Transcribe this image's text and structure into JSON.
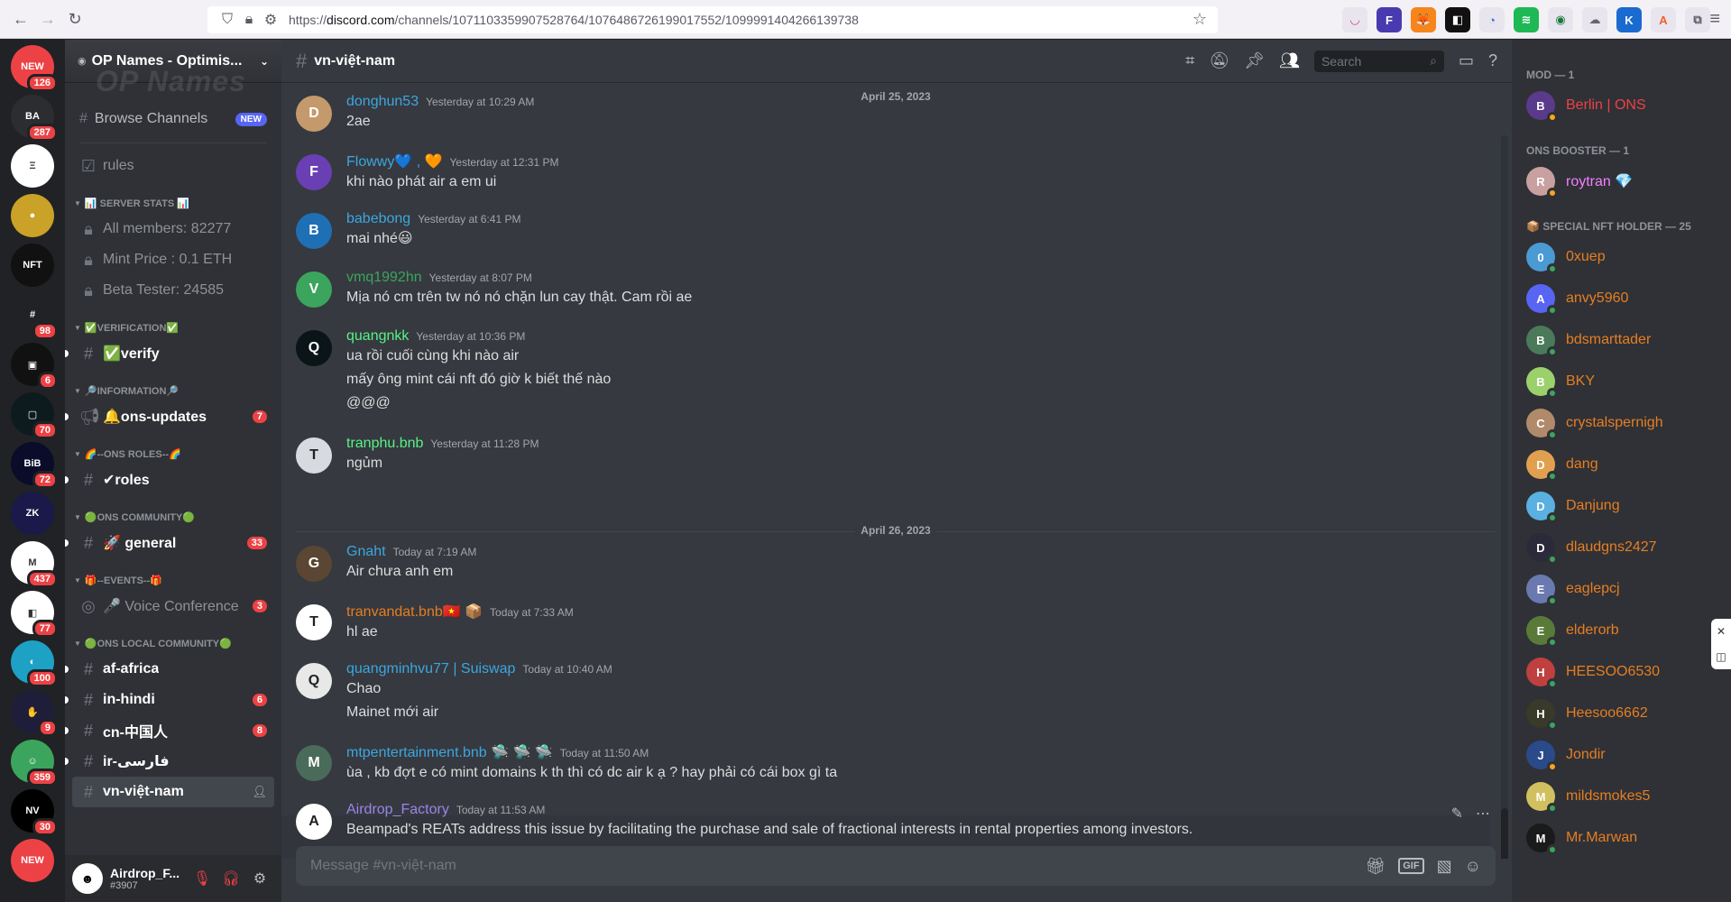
{
  "browser": {
    "url_prefix": "https://",
    "url_domain": "discord.com",
    "url_path": "/channels/1071103359907528764/1076486726199017552/1099991404266139738"
  },
  "servers": [
    {
      "label": "NEW",
      "badge": "126",
      "color": "#ed4245",
      "new": "NEW"
    },
    {
      "label": "BA",
      "badge": "287",
      "color": "#2b2d31"
    },
    {
      "label": "Ξ",
      "badge": "",
      "color": "#ffffff"
    },
    {
      "label": "●",
      "badge": "",
      "color": "#c9a227"
    },
    {
      "label": "NFT",
      "badge": "",
      "color": "#111111"
    },
    {
      "label": "#",
      "badge": "98",
      "color": "#202225"
    },
    {
      "label": "▣",
      "badge": "6",
      "color": "#111111"
    },
    {
      "label": "▢",
      "badge": "70",
      "color": "#0d1b1e"
    },
    {
      "label": "BiB",
      "badge": "72",
      "color": "#0b0b2a"
    },
    {
      "label": "ZK",
      "badge": "",
      "color": "#1a1a4a"
    },
    {
      "label": "M",
      "badge": "437",
      "color": "#ffffff"
    },
    {
      "label": "◧",
      "badge": "77",
      "color": "#ffffff"
    },
    {
      "label": "◐",
      "badge": "100",
      "color": "#1da1c4"
    },
    {
      "label": "✋",
      "badge": "9",
      "color": "#1e1e3a"
    },
    {
      "label": "☺",
      "badge": "359",
      "color": "#3ba55d"
    },
    {
      "label": "NV",
      "badge": "30",
      "color": "#000000"
    },
    {
      "label": "NEW",
      "badge": "",
      "color": "#ed4245",
      "new": "NEW"
    }
  ],
  "guild": {
    "name": "OP Names - Optimis...",
    "banner": "OP Names",
    "browse_label": "Browse Channels",
    "browse_badge": "NEW"
  },
  "channels": {
    "rules": "rules",
    "cat_server_stats": "📊 SERVER STATS 📊",
    "all_members": "All members: 82277",
    "mint_price": "Mint Price : 0.1 ETH",
    "beta_tester": "Beta Tester: 24585",
    "cat_verification": "✅VERIFICATION✅",
    "verify": "✅verify",
    "cat_information": "🔎INFORMATION🔎",
    "ons_updates": "🔔ons-updates",
    "ons_updates_count": "7",
    "cat_ons_roles": "🌈--ONS ROLES--🌈",
    "roles": "✔roles",
    "cat_ons_community": "🟢ONS COMMUNITY🟢",
    "general": "🚀 general",
    "general_count": "33",
    "cat_events": "🎁--EVENTS--🎁",
    "voice_conf": "🎤 Voice Conference",
    "voice_conf_count": "3",
    "cat_local": "🟢ONS LOCAL COMMUNITY🟢",
    "af_africa": "af-africa",
    "in_hindi": "in-hindi",
    "in_hindi_count": "6",
    "cn": "cn-中国人",
    "cn_count": "8",
    "ir": "ir-فارسی",
    "vn": "vn-việt-nam"
  },
  "user_panel": {
    "name": "Airdrop_F...",
    "tag": "#3907"
  },
  "chat": {
    "channel": "vn-việt-nam",
    "search_placeholder": "Search",
    "composer_placeholder": "Message #vn-việt-nam",
    "gif_label": "GIF",
    "partial_date": "April 25, 2023",
    "date_divider": "April 26, 2023",
    "messages": [
      {
        "user": "donghun53",
        "color": "#3ba7e0",
        "time": "Yesterday at 10:29 AM",
        "lines": [
          "2ae"
        ],
        "av": "#c49a6c"
      },
      {
        "user": "Flowwy💙 , 🧡",
        "color": "#3ba7e0",
        "time": "Yesterday at 12:31 PM",
        "lines": [
          "khi nào phát air a em ui"
        ],
        "av": "#6a3fb4"
      },
      {
        "user": "babebong",
        "color": "#3ba7e0",
        "time": "Yesterday at 6:41 PM",
        "lines": [
          "mai nhé😃"
        ],
        "av": "#1f6fb5"
      },
      {
        "user": "vmq1992hn",
        "color": "#3ba55d",
        "time": "Yesterday at 8:07 PM",
        "lines": [
          "Mịa nó cm trên tw nó nó chặn lun cay thật. Cam rồi ae"
        ],
        "av": "#3ba55d"
      },
      {
        "user": "quangnkk",
        "color": "#57f287",
        "time": "Yesterday at 10:36 PM",
        "lines": [
          "ua rồi cuối cùng khi nào air",
          "mấy ông mint cái nft đó giờ k biết thế nào",
          "@@@"
        ],
        "av": "#0b1416"
      },
      {
        "user": "tranphu.bnb",
        "color": "#57f287",
        "time": "Yesterday at 11:28 PM",
        "lines": [
          "ngủm"
        ],
        "av": "#d7dadf"
      },
      {
        "user": "Gnaht",
        "color": "#3ba7e0",
        "time": "Today at 7:19 AM",
        "lines": [
          "Air chưa anh em"
        ],
        "av": "#5a4632"
      },
      {
        "user": "tranvandat.bnb🇻🇳 📦",
        "color": "#e67e22",
        "time": "Today at 7:33 AM",
        "lines": [
          "hl ae"
        ],
        "av": "#ffffff"
      },
      {
        "user": "quangminhvu77 | Suiswap",
        "color": "#3ba7e0",
        "time": "Today at 10:40 AM",
        "lines": [
          "Chao",
          "Mainet mới air"
        ],
        "av": "#e8e8e8"
      },
      {
        "user": "mtpentertainment.bnb 🛸 🛸 🛸",
        "color": "#3ba7e0",
        "time": "Today at 11:50 AM",
        "lines": [
          "ùa , kb đợt e có mint domains k th thì có dc air k ạ ? hay phải có cái box gì ta"
        ],
        "av": "#4a6b5a"
      },
      {
        "user": "Airdrop_Factory",
        "color": "#9b84ec",
        "time": "Today at 11:53 AM",
        "lines": [
          "Beampad's REATs address this issue by facilitating the purchase and sale of fractional interests in rental properties among investors."
        ],
        "av": "#ffffff"
      }
    ]
  },
  "members": {
    "categories": [
      {
        "title": "MOD — 1",
        "members": [
          {
            "name": "Berlin | ONS",
            "color": "#ed4245",
            "av": "#5a3a8a",
            "status": "#faa61a"
          }
        ]
      },
      {
        "title": "ONS BOOSTER — 1",
        "members": [
          {
            "name": "roytran 💎",
            "color": "#f47fff",
            "av": "#c8a0a0",
            "status": "#faa61a"
          }
        ]
      },
      {
        "title": "📦 SPECIAL NFT HOLDER — 25",
        "members": [
          {
            "name": "0xuep",
            "color": "#e67e22",
            "av": "#4a9ad4",
            "status": "#3ba55d"
          },
          {
            "name": "anvy5960",
            "color": "#e67e22",
            "av": "#5865f2",
            "status": "#3ba55d"
          },
          {
            "name": "bdsmarttader",
            "color": "#e67e22",
            "av": "#4a7a5a",
            "status": "#3ba55d"
          },
          {
            "name": "BKY",
            "color": "#e67e22",
            "av": "#9bd06a",
            "status": "#3ba55d"
          },
          {
            "name": "crystalspernigh",
            "color": "#e67e22",
            "av": "#b08a6a",
            "status": "#3ba55d"
          },
          {
            "name": "dang",
            "color": "#e67e22",
            "av": "#e0a050",
            "status": "#3ba55d"
          },
          {
            "name": "Danjung",
            "color": "#e67e22",
            "av": "#5ab0e0",
            "status": "#3ba55d"
          },
          {
            "name": "dlaudgns2427",
            "color": "#e67e22",
            "av": "#2a2a3a",
            "status": "#3ba55d"
          },
          {
            "name": "eaglepcj",
            "color": "#e67e22",
            "av": "#6a7ab0",
            "status": "#3ba55d"
          },
          {
            "name": "elderorb",
            "color": "#e67e22",
            "av": "#5a7a3a",
            "status": "#3ba55d"
          },
          {
            "name": "HEESOO6530",
            "color": "#e67e22",
            "av": "#c04040",
            "status": "#3ba55d"
          },
          {
            "name": "Heesoo6662",
            "color": "#e67e22",
            "av": "#3a3a2a",
            "status": "#3ba55d"
          },
          {
            "name": "Jondir",
            "color": "#e67e22",
            "av": "#2a4a8a",
            "status": "#faa61a"
          },
          {
            "name": "mildsmokes5",
            "color": "#e67e22",
            "av": "#d0c060",
            "status": "#3ba55d"
          },
          {
            "name": "Mr.Marwan",
            "color": "#e67e22",
            "av": "#1a1a1a",
            "status": "#3ba55d"
          }
        ]
      }
    ]
  }
}
